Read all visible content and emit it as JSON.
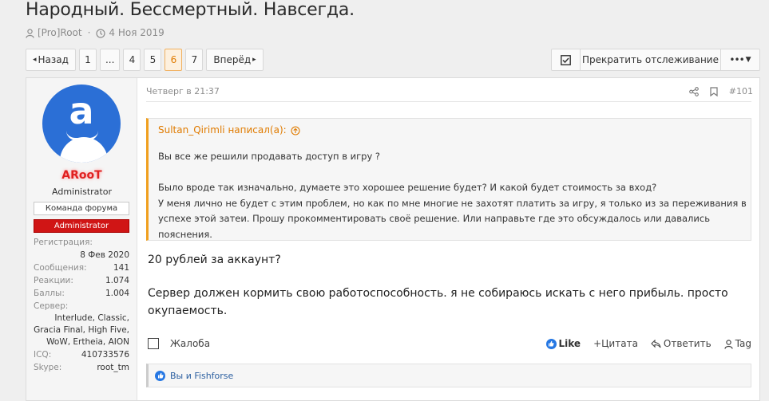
{
  "thread": {
    "title": "Народный. Бессмертный. Навсегда.",
    "author": "[Pro]Root",
    "date": "4 Ноя 2019"
  },
  "pager": {
    "prev": "Назад",
    "pages": [
      "1",
      "...",
      "4",
      "5",
      "6",
      "7"
    ],
    "active_page": "6",
    "next": "Вперёд"
  },
  "watch": {
    "label": "Прекратить отслеживание"
  },
  "user": {
    "avatar_letter": "a",
    "name": "ARooT",
    "title": "Administrator",
    "banner_team": "Команда форума",
    "banner_admin": "Administrator",
    "reg_key": "Регистрация:",
    "reg_val": "8 Фев 2020",
    "msg_key": "Сообщения:",
    "msg_val": "141",
    "react_key": "Реакции:",
    "react_val": "1.074",
    "points_key": "Баллы:",
    "points_val": "1.004",
    "server_key": "Сервер:",
    "server_val": "Interlude, Classic, Gracia Final, High Five, WoW, Ertheia, AION",
    "icq_key": "ICQ:",
    "icq_val": "410733576",
    "skype_key": "Skype:",
    "skype_val": "root_tm"
  },
  "post": {
    "date": "Четверг в 21:37",
    "number": "#101",
    "quote_author": "Sultan_Qirimli написал(а):",
    "quote_lines": [
      "Вы все же решили продавать доступ в игру ?",
      "",
      "Было вроде так изначально, думаете это хорошее решение будет? И какой будет стоимость за вход?",
      "У меня лично не будет с этим проблем, но как по мне многие не захотят платить за игру, я только из за переживания в",
      "успехе этой затеи. Прошу прокомментировать своё решение. Или направьте где это обсуждалось или давались",
      "пояснения."
    ],
    "reply_p1": "20 рублей за аккаунт?",
    "reply_p2": "Сервер должен кормить свою работоспособность. я не собираюсь искать с него прибыль. просто окупаемость."
  },
  "actions": {
    "report": "Жалоба",
    "like": "Like",
    "quote": "+Цитата",
    "reply": "Ответить",
    "tag": "Tag"
  },
  "reactions": {
    "text": "Вы и Fishforse"
  },
  "colors": {
    "accent": "#e07b00",
    "admin_red": "#d01515",
    "link_blue": "#2b5fa0",
    "avatar_blue": "#2b6fd6"
  }
}
